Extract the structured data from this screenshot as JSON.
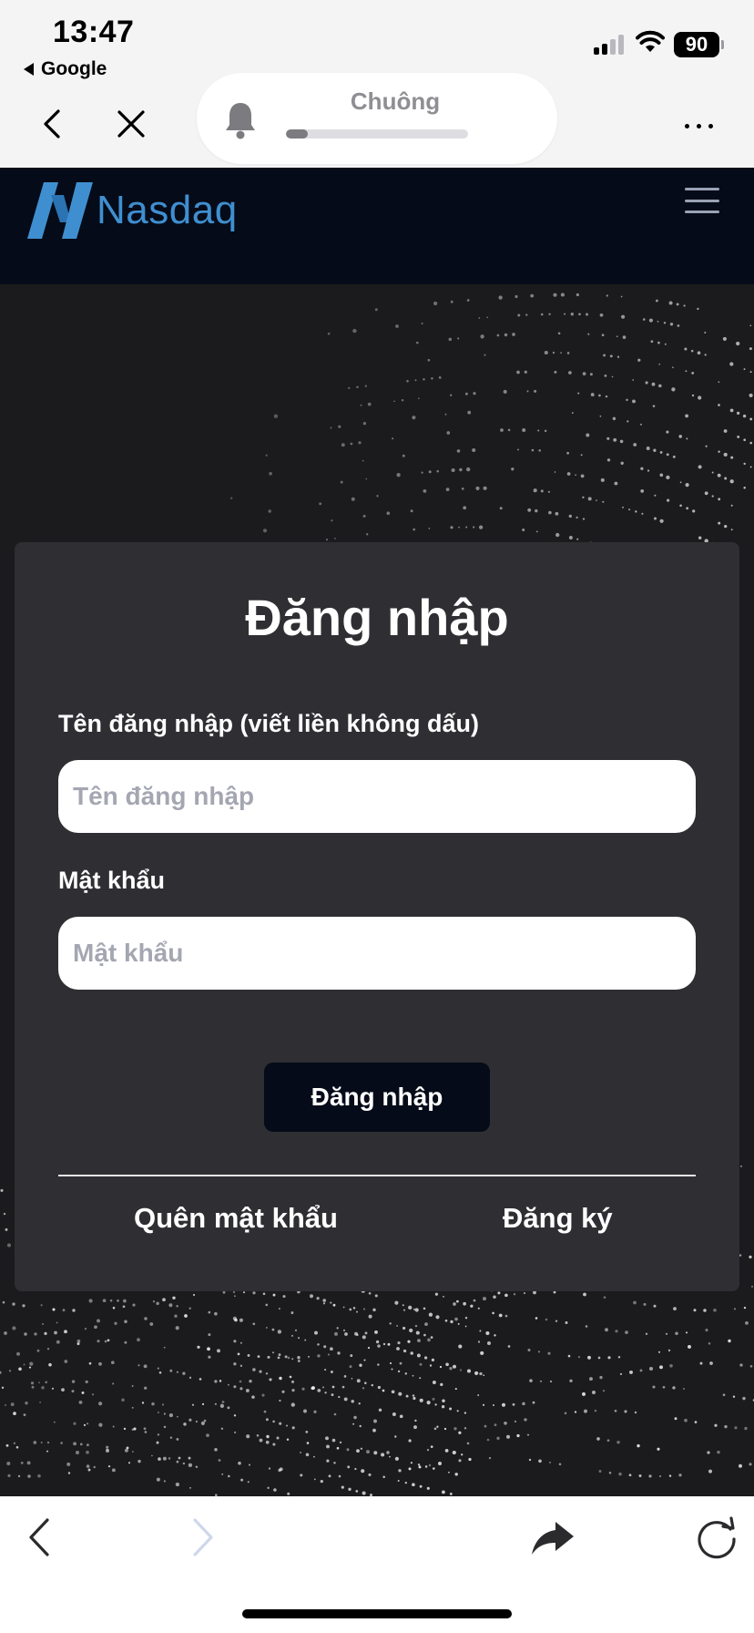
{
  "status_bar": {
    "time": "13:47",
    "back_app": "Google",
    "battery": "90"
  },
  "browser": {
    "pill_title": "Chuông",
    "progress": 0.12,
    "icons": [
      "chevron-left-icon",
      "close-icon",
      "bell-icon",
      "more-icon"
    ]
  },
  "site": {
    "logo_text": "Nasdaq",
    "brand_color": "#3f8fd0",
    "header_bg": "#050b18"
  },
  "login": {
    "title": "Đăng nhập",
    "username_label": "Tên đăng nhập (viết liền không dấu)",
    "username_placeholder": "Tên đăng nhập",
    "username_value": "",
    "password_label": "Mật khẩu",
    "password_placeholder": "Mật khẩu",
    "password_value": "",
    "submit_label": "Đăng nhập",
    "forgot_label": "Quên mật khẩu",
    "register_label": "Đăng ký"
  },
  "toolbar": {
    "icons": [
      "back-arrow-icon",
      "forward-arrow-icon",
      "share-icon",
      "reload-icon"
    ]
  }
}
